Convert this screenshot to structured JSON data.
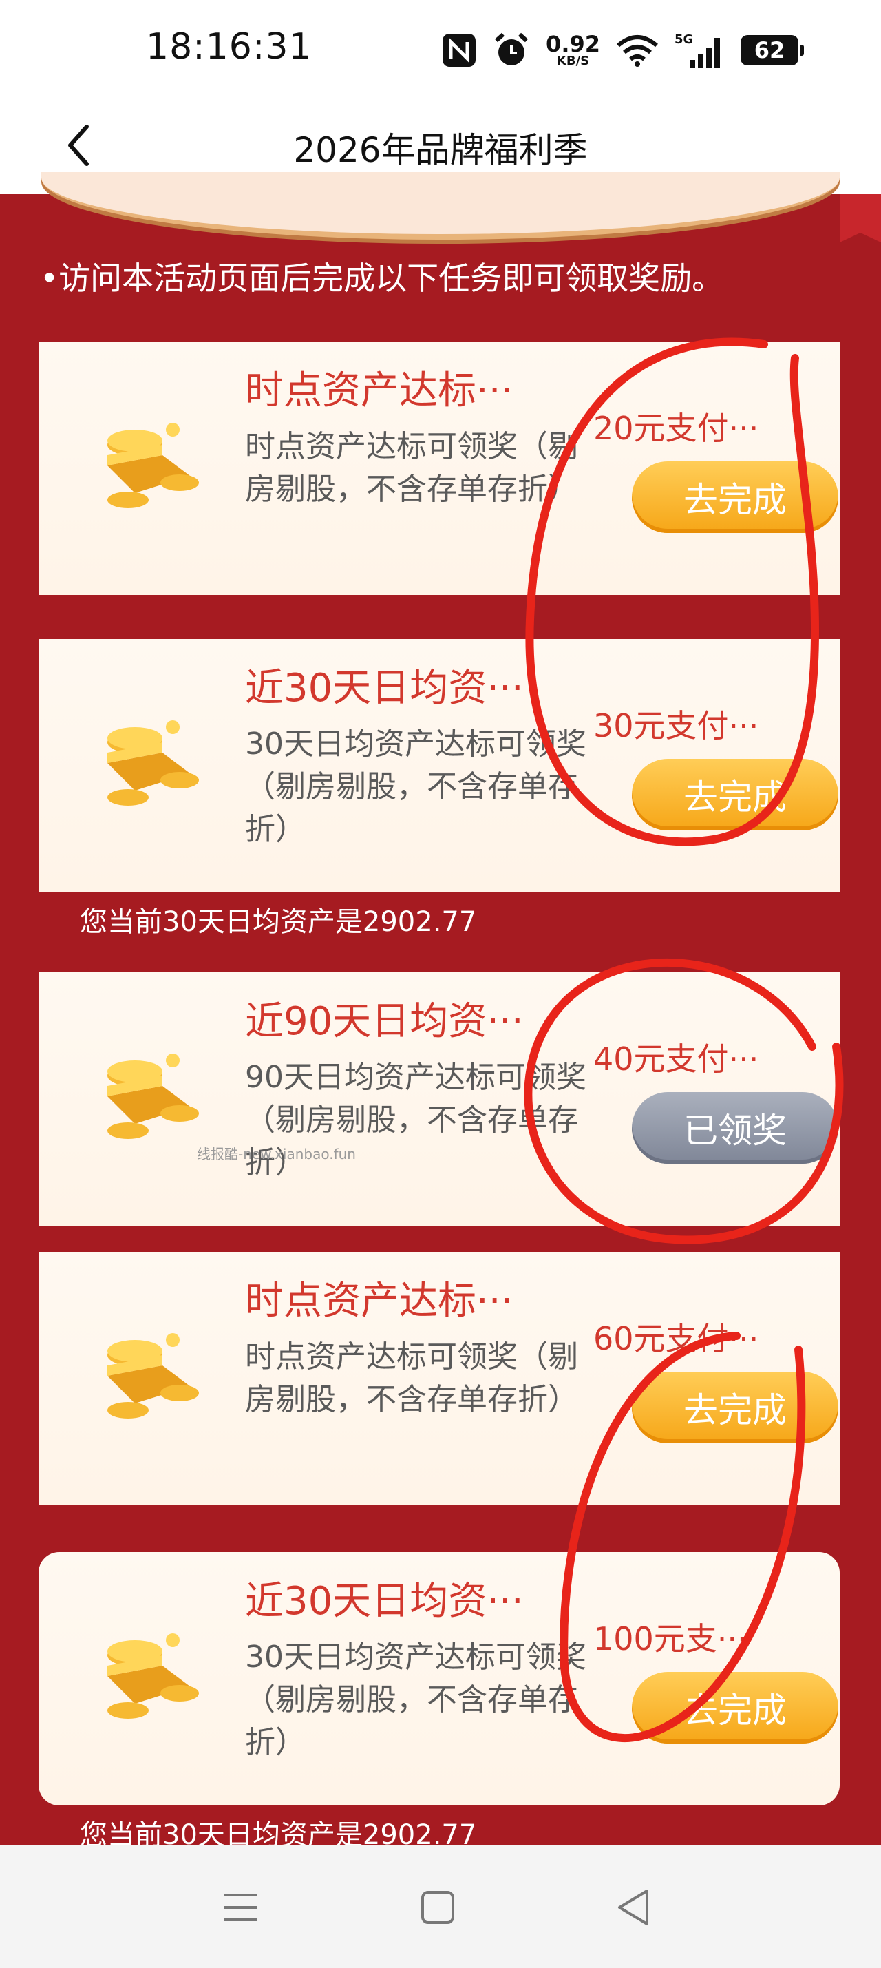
{
  "status_bar": {
    "time": "18:16:31",
    "net_speed": "0.92",
    "net_unit": "KB/S",
    "network": "5G",
    "battery": "62"
  },
  "header": {
    "title": "2026年品牌福利季"
  },
  "intro": "•访问本活动页面后完成以下任务即可领取奖励。",
  "tasks": [
    {
      "title": "时点资产达标···",
      "desc": "时点资产达标可领奖（剔房剔股，不含存单存折）",
      "reward": "20元支付···",
      "button": "去完成",
      "state": "pending"
    },
    {
      "title": "近30天日均资···",
      "desc": "30天日均资产达标可领奖（剔房剔股，不含存单存折）",
      "reward": "30元支付···",
      "button": "去完成",
      "state": "pending"
    },
    {
      "title": "近90天日均资···",
      "desc": "90天日均资产达标可领奖（剔房剔股，不含存单存折）",
      "reward": "40元支付···",
      "button": "已领奖",
      "state": "claimed"
    },
    {
      "title": "时点资产达标···",
      "desc": "时点资产达标可领奖（剔房剔股，不含存单存折）",
      "reward": "60元支付···",
      "button": "去完成",
      "state": "pending"
    },
    {
      "title": "近30天日均资···",
      "desc": "30天日均资产达标可领奖（剔房剔股，不含存单存折）",
      "reward": "100元支···",
      "button": "去完成",
      "state": "pending"
    }
  ],
  "notes": [
    "您当前30天日均资产是2902.77",
    "您当前30天日均资产是2902.77"
  ],
  "watermark": "线报酷-new.xianbao.fun",
  "colors": {
    "page_bg": "#a61b21",
    "accent_red": "#d2382d",
    "button_gold": "#f6a617",
    "button_grey": "#8a90a0",
    "annotation_red": "#e8241a"
  },
  "icons": [
    "back-icon",
    "nfc-icon",
    "alarm-icon",
    "wifi-icon",
    "signal-icon",
    "battery-icon",
    "gold-coins-icon",
    "menu-icon",
    "home-icon",
    "back-triangle-icon"
  ]
}
